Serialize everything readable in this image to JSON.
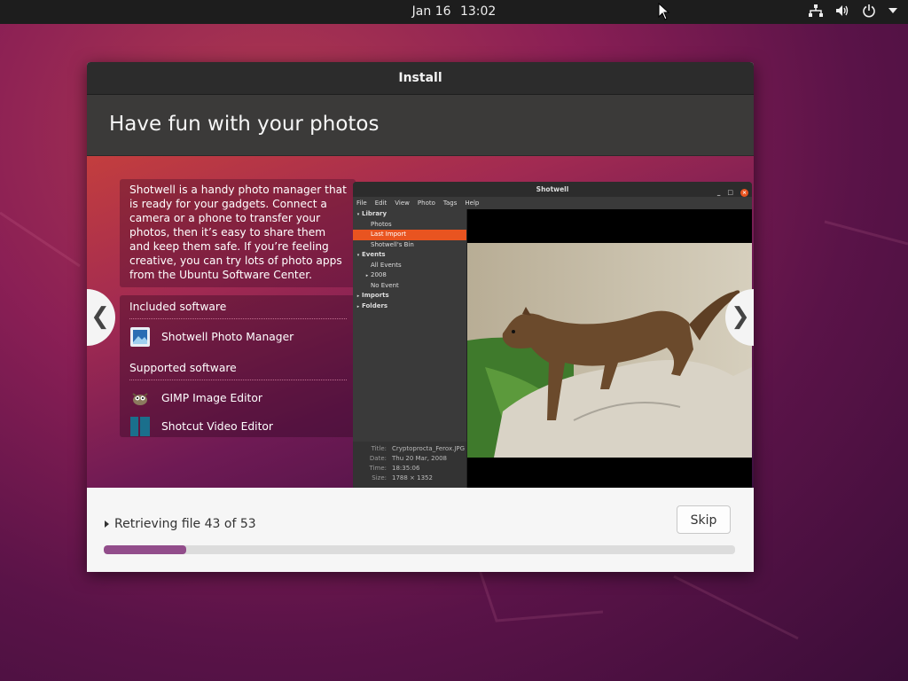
{
  "topbar": {
    "date": "Jan 16",
    "time": "13:02",
    "icons": [
      "network-icon",
      "volume-icon",
      "power-icon",
      "menu-arrow-icon"
    ]
  },
  "window": {
    "title": "Install",
    "header": "Have fun with your photos",
    "description": "Shotwell is a handy photo manager that is ready for your gadgets. Connect a camera or a phone to transfer your photos, then it’s easy to share them and keep them safe. If you’re feeling creative, you can try lots of photo apps from the Ubuntu Software Center.",
    "included_heading": "Included software",
    "included": [
      {
        "name": "Shotwell Photo Manager",
        "icon": "shotwell-icon"
      }
    ],
    "supported_heading": "Supported software",
    "supported": [
      {
        "name": "GIMP Image Editor",
        "icon": "gimp-icon"
      },
      {
        "name": "Shotcut Video Editor",
        "icon": "shotcut-icon"
      }
    ],
    "prev_arrow": "❮",
    "next_arrow": "❯"
  },
  "shotwell": {
    "title": "Shotwell",
    "controls": [
      "_",
      "□",
      "×"
    ],
    "menu": [
      "File",
      "Edit",
      "View",
      "Photo",
      "Tags",
      "Help"
    ],
    "tree": [
      {
        "label": "Library",
        "level": 0,
        "twisty": "▾",
        "bold": true
      },
      {
        "label": "Photos",
        "level": 1
      },
      {
        "label": "Last Import",
        "level": 1,
        "selected": true
      },
      {
        "label": "Shotwell's Bin",
        "level": 1
      },
      {
        "label": "Events",
        "level": 0,
        "twisty": "▾",
        "bold": true
      },
      {
        "label": "All Events",
        "level": 1
      },
      {
        "label": "2008",
        "level": 1,
        "twisty": "▸"
      },
      {
        "label": "No Event",
        "level": 1
      },
      {
        "label": "Imports",
        "level": 0,
        "twisty": "▸",
        "bold": true
      },
      {
        "label": "Folders",
        "level": 0,
        "twisty": "▸",
        "bold": true
      }
    ],
    "metadata": [
      {
        "key": "Title:",
        "value": "Cryptoprocta_Ferox.JPG"
      },
      {
        "key": "Date:",
        "value": "Thu 20 Mar, 2008"
      },
      {
        "key": "Time:",
        "value": "18:35:06"
      },
      {
        "key": "Size:",
        "value": "1788 × 1352"
      }
    ]
  },
  "footer": {
    "status": "Retrieving file 43 of 53",
    "skip_label": "Skip",
    "progress_fraction": 0.13
  },
  "colors": {
    "accent": "#e95420",
    "progress": "#924d8b"
  }
}
